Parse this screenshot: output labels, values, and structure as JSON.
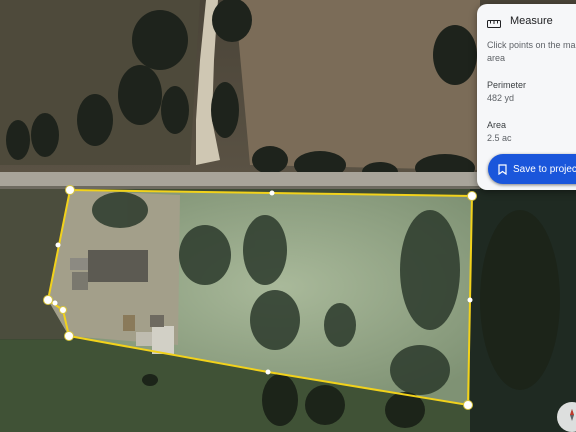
{
  "measure_panel": {
    "title": "Measure",
    "instructions": "Click points on the map area",
    "perimeter_label": "Perimeter",
    "perimeter_value": "482 yd",
    "area_label": "Area",
    "area_value": "2.5 ac",
    "icon": "ruler-icon"
  },
  "save_button": {
    "label": "Save to project",
    "icon": "bookmark-icon"
  },
  "compass": {
    "icon": "compass-icon"
  },
  "colors": {
    "outline": "#f2d21b",
    "button": "#1a56db",
    "panel": "#f6f7f9"
  }
}
